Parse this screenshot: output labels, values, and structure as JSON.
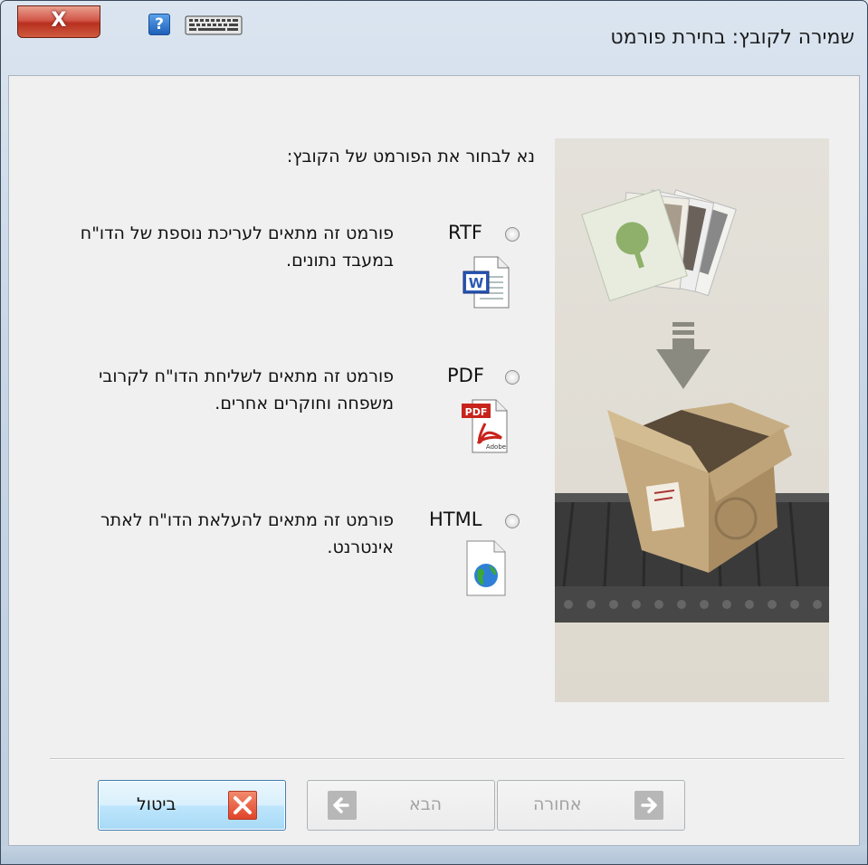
{
  "window": {
    "title": "שמירה לקובץ: בחירת פורמט",
    "help_label": "?",
    "close_label": "X"
  },
  "main": {
    "prompt": "נא לבחור את הפורמט של הקובץ:",
    "options": [
      {
        "label": "RTF",
        "description": "פורמט זה מתאים לעריכת נוספת של הדו\"ח במעבד נתונים.",
        "icon": "word-document-icon"
      },
      {
        "label": "PDF",
        "description": "פורמט זה מתאים לשליחת הדו\"ח לקרובי משפחה וחוקרים אחרים.",
        "icon": "pdf-document-icon"
      },
      {
        "label": "HTML",
        "description": "פורמט זה מתאים להעלאת הדו\"ח לאתר אינטרנט.",
        "icon": "html-globe-icon"
      }
    ]
  },
  "buttons": {
    "cancel": "ביטול",
    "next": "הבא",
    "back": "אחורה"
  },
  "colors": {
    "accent": "#3c7fb1",
    "close_red": "#c8402c"
  }
}
